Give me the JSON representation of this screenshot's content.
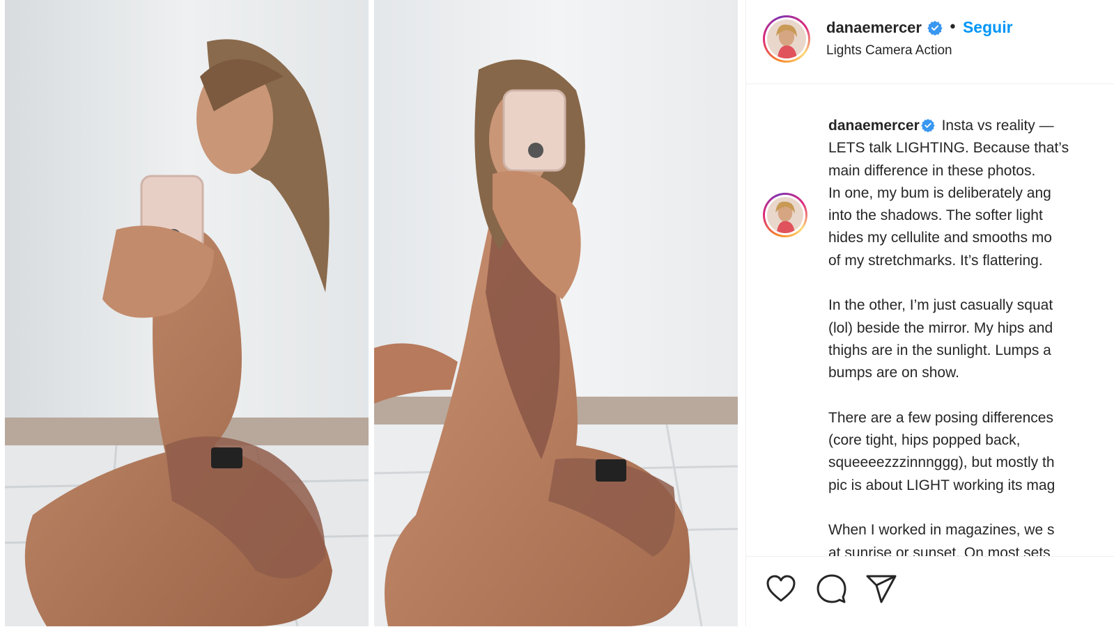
{
  "post": {
    "username": "danaemercer",
    "location": "Lights Camera Action",
    "follow_label": "Seguir",
    "separator": "•",
    "caption_username": "danaemercer",
    "caption_text": " Insta vs reality —\nLETS talk LIGHTING. Because that’s\nmain difference in these photos.\nIn one, my bum is deliberately ang\ninto the shadows. The softer light\nhides my cellulite and smooths mo\nof my stretchmarks. It’s flattering.\n\nIn the other, I’m just casually squat\n(lol) beside the mirror. My hips and\nthighs are in the sunlight. Lumps a\nbumps are on show.\n\nThere are a few posing differences\n(core tight, hips popped back,\nsqueeeezzzinnnggg), but mostly th\npic is about LIGHT working its mag\n\nWhen I worked in magazines, we s\nat sunrise or sunset. On most sets"
  },
  "icons": {
    "verified": "verified-badge-icon",
    "like": "heart-icon",
    "comment": "comment-bubble-icon",
    "share": "paper-plane-icon"
  },
  "colors": {
    "accent": "#0095f6",
    "text": "#262626",
    "divider": "#efefef",
    "verified": "#3897f0"
  }
}
